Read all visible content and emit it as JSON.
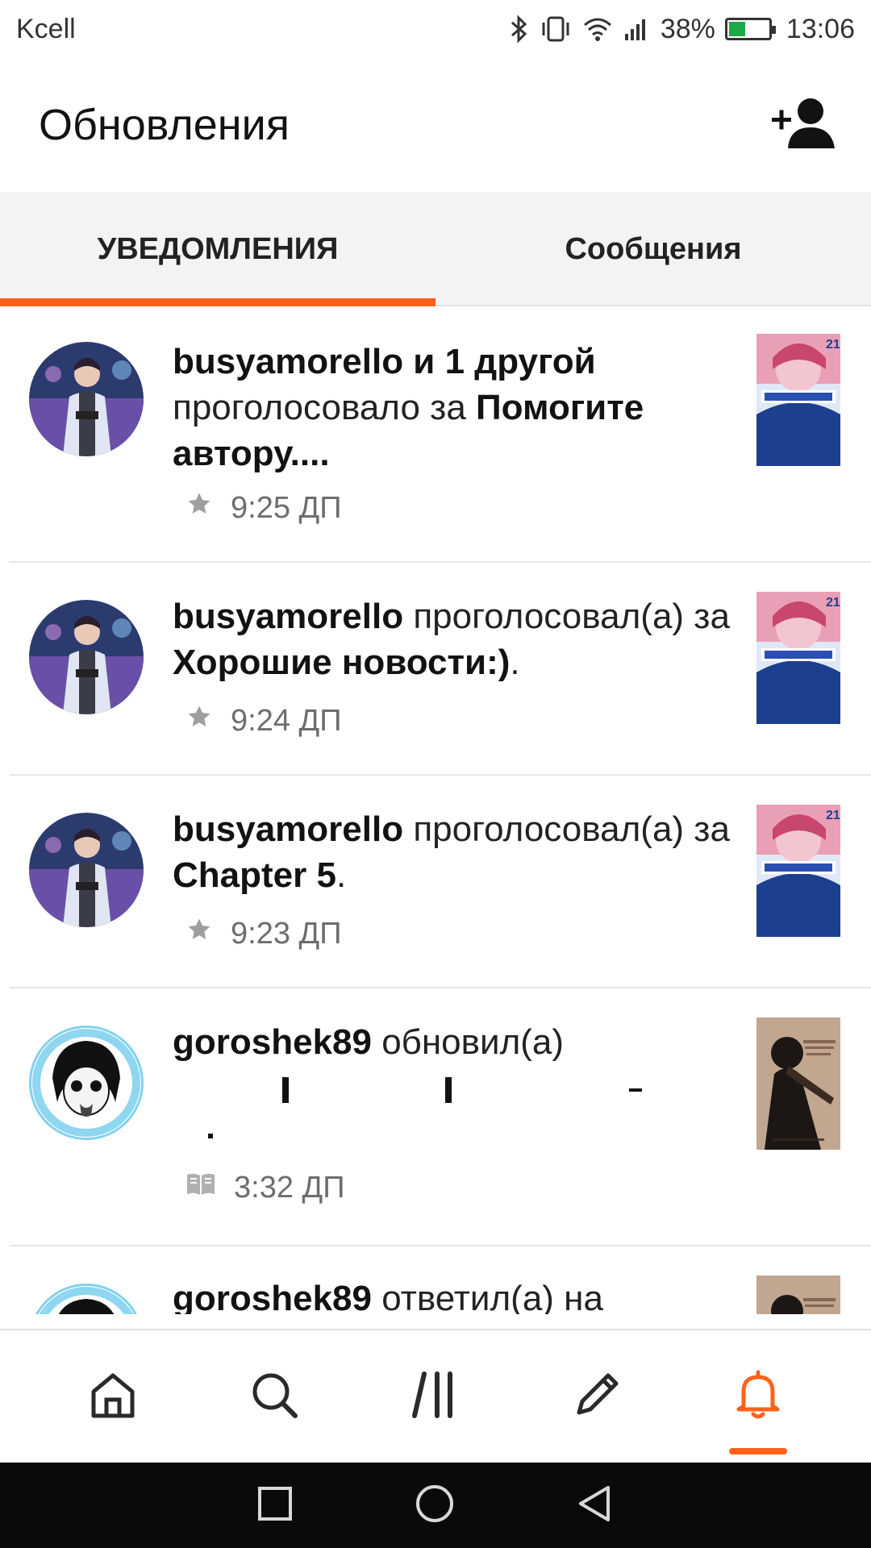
{
  "status_bar": {
    "carrier": "Kcell",
    "battery_percent": "38%",
    "time": "13:06",
    "battery_level": 0.38,
    "icons": [
      "bluetooth-icon",
      "vibrate-icon",
      "wifi-icon",
      "signal-icon",
      "battery-icon"
    ]
  },
  "header": {
    "title": "Обновления",
    "add_user_icon": "add-user-icon"
  },
  "tabs": [
    {
      "label": "УВЕДОМЛЕНИЯ",
      "active": true
    },
    {
      "label": "Сообщения",
      "active": false
    }
  ],
  "notifications": [
    {
      "user": "busyamorello и 1 другой",
      "action": " проголосовало за ",
      "target": "Помогите автору....",
      "suffix": "",
      "time": "9:25 ДП",
      "meta_icon": "star-icon"
    },
    {
      "user": "busyamorello",
      "action": " проголосовал(а) за ",
      "target": "Хорошие новости:)",
      "suffix": ".",
      "time": "9:24 ДП",
      "meta_icon": "star-icon"
    },
    {
      "user": "busyamorello",
      "action": " проголосовал(а) за ",
      "target": "Chapter 5",
      "suffix": ".",
      "time": "9:23 ДП",
      "meta_icon": "star-icon"
    },
    {
      "user": "goroshek89",
      "action": " обновил(а)",
      "target": "",
      "suffix": "",
      "time": "3:32 ДП",
      "meta_icon": "book-icon"
    },
    {
      "user": "goroshek89",
      "action": " ответил(а) на",
      "target": "",
      "suffix": "",
      "time": "",
      "meta_icon": ""
    }
  ],
  "bottom_nav": [
    {
      "icon": "home-icon",
      "active": false
    },
    {
      "icon": "search-icon",
      "active": false
    },
    {
      "icon": "library-icon",
      "active": false
    },
    {
      "icon": "write-icon",
      "active": false
    },
    {
      "icon": "bell-icon",
      "active": true
    }
  ],
  "colors": {
    "accent": "#ff6119",
    "tab_bg": "#f3f3f3",
    "text": "#121212",
    "muted": "#6d6d6d"
  }
}
